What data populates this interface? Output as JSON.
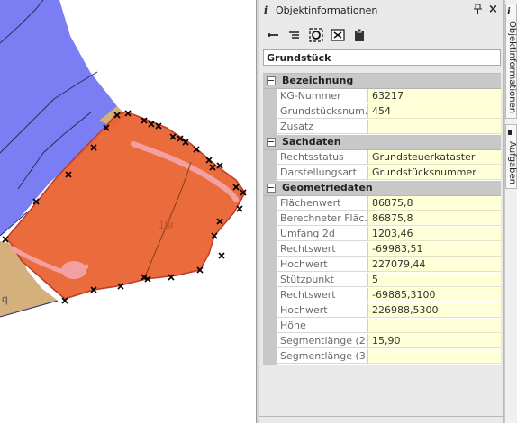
{
  "map": {
    "parcel_label": "18r",
    "edge_label": "q"
  },
  "panel": {
    "title": "Objektinformationen",
    "pin_glyph": "↕",
    "close_glyph": "✕",
    "object_type": "Grundstück"
  },
  "toolbar": {
    "icons": [
      "collapse-icon",
      "expand-icon",
      "zoom-to-object-icon",
      "export-icon",
      "clipboard-icon"
    ]
  },
  "properties": {
    "bezeichnung": {
      "label": "Bezeichnung",
      "rows": [
        {
          "key": "KG-Nummer",
          "value": "63217"
        },
        {
          "key": "Grundstücksnum...",
          "value": "454"
        },
        {
          "key": "Zusatz",
          "value": ""
        }
      ]
    },
    "sachdaten": {
      "label": "Sachdaten",
      "rows": [
        {
          "key": "Rechtsstatus",
          "value": "Grundsteuerkataster"
        },
        {
          "key": "Darstellungsart",
          "value": "Grundstücksnummer"
        }
      ]
    },
    "geometriedaten": {
      "label": "Geometriedaten",
      "rows": [
        {
          "key": "Flächenwert",
          "value": "86875,8"
        },
        {
          "key": "Berechneter Fläc...",
          "value": "86875,8"
        },
        {
          "key": "Umfang 2d",
          "value": "1203,46"
        },
        {
          "key": "Rechtswert",
          "value": "-69983,51"
        },
        {
          "key": "Hochwert",
          "value": "227079,44"
        },
        {
          "key": "Stützpunkt",
          "value": "5"
        },
        {
          "key": "Rechtswert",
          "value": "-69885,3100"
        },
        {
          "key": "Hochwert",
          "value": "226988,5300"
        },
        {
          "key": "Höhe",
          "value": ""
        },
        {
          "key": "Segmentlänge (2...",
          "value": "15,90"
        },
        {
          "key": "Segmentlänge (3...",
          "value": ""
        }
      ]
    }
  },
  "side_tabs": {
    "info_label": "Objektinformationen",
    "tasks_label": "Aufgaben"
  },
  "colors": {
    "parcel_fill": "#e8602c",
    "parcel_border": "#c0392b",
    "field_blue": "#7b7ef2",
    "field_tan": "#d3b07c",
    "value_background": "#ffffd8",
    "category_background": "#c8c8c8"
  }
}
